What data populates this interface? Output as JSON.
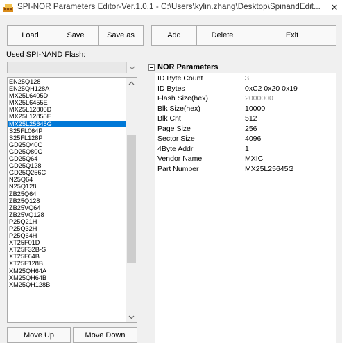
{
  "window": {
    "title": "SPI-NOR Parameters Editor-Ver.1.0.1 - C:\\Users\\kylin.zhang\\Desktop\\SpinandEdit...",
    "close_glyph": "✕"
  },
  "toolbar": {
    "load_label": "Load",
    "save_label": "Save",
    "save_as_label": "Save as",
    "add_label": "Add",
    "delete_label": "Delete",
    "exit_label": "Exit"
  },
  "flash_panel": {
    "label": "Used SPI-NAND Flash:",
    "combo_value": "",
    "items": [
      "EN25Q128",
      "EN25QH128A",
      "MX25L6405D",
      "MX25L6455E",
      "MX25L12805D",
      "MX25L12855E",
      "MX25L25645G",
      "S25FL064P",
      "S25FL128P",
      "GD25Q40C",
      "GD25Q80C",
      "GD25Q64",
      "GD25Q128",
      "GD25Q256C",
      "N25Q64",
      "N25Q128",
      "ZB25Q64",
      "ZB25Q128",
      "ZB25VQ64",
      "ZB25VQ128",
      "P25Q21H",
      "P25Q32H",
      "P25Q64H",
      "XT25F01D",
      "XT25F32B-S",
      "XT25F64B",
      "XT25F128B",
      "XM25QH64A",
      "XM25QH64B",
      "XM25QH128B"
    ],
    "selected_index": 6,
    "selection_color": "#0078d7",
    "move_up_label": "Move Up",
    "move_down_label": "Move Down"
  },
  "nor_parameters": {
    "category": "NOR Parameters",
    "rows": [
      {
        "key": "ID Byte Count",
        "value": "3",
        "dim": false
      },
      {
        "key": "ID Bytes",
        "value": "0xC2 0x20 0x19",
        "dim": false
      },
      {
        "key": "Flash Size(hex)",
        "value": "2000000",
        "dim": true
      },
      {
        "key": "Blk Size(hex)",
        "value": "10000",
        "dim": false
      },
      {
        "key": "Blk Cnt",
        "value": "512",
        "dim": false
      },
      {
        "key": "Page Size",
        "value": "256",
        "dim": false
      },
      {
        "key": "Sector Size",
        "value": "4096",
        "dim": false
      },
      {
        "key": "4Byte Addr",
        "value": "1",
        "dim": false
      },
      {
        "key": "Vendor Name",
        "value": "MXIC",
        "dim": false
      },
      {
        "key": "Part Number",
        "value": "MX25L25645G",
        "dim": false
      }
    ]
  }
}
